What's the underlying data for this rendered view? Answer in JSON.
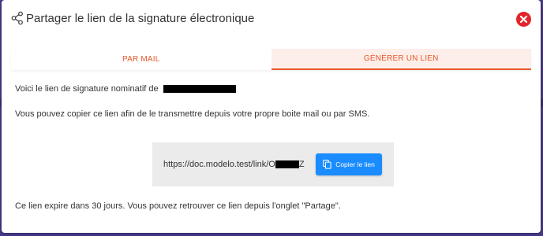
{
  "modal": {
    "title": "Partager le lien de la signature électronique",
    "title_icon": "share-icon",
    "close_icon": "close-icon"
  },
  "tabs": [
    {
      "label": "PAR MAIL",
      "active": false
    },
    {
      "label": "GÉNÉRER UN LIEN",
      "active": true
    }
  ],
  "content": {
    "intro_text": "Voici le lien de signature nominatif de",
    "copy_instructions": "Vous pouvez copier ce lien afin de le transmettre depuis votre propre boite mail ou par SMS.",
    "link_prefix": "https://doc.modelo.test/link/O",
    "link_suffix": "Z",
    "copy_button_label": "Copier le lien",
    "copy_button_icon": "copy-icon",
    "expiry_text": "Ce lien expire dans 30 jours. Vous pouvez retrouver ce lien depuis l'onglet \"Partage\"."
  },
  "colors": {
    "accent": "#e8572b",
    "active_tab_bg": "#fdeee9",
    "button_blue": "#1a8cff",
    "close_red": "#e3242b",
    "backdrop": "#4a3a8c"
  }
}
